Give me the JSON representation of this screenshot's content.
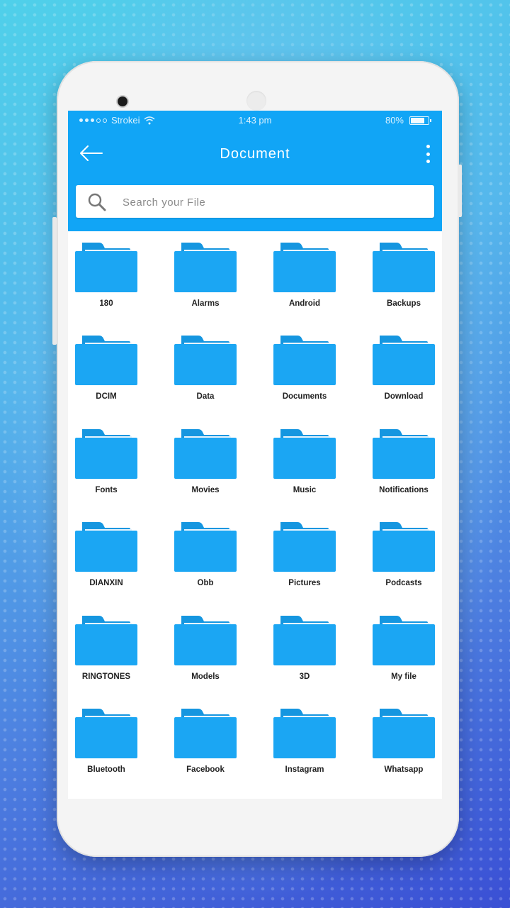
{
  "status_bar": {
    "carrier": "Strokei",
    "time": "1:43 pm",
    "battery": "80%",
    "battery_level": 0.8
  },
  "header": {
    "title": "Document",
    "back_icon": "arrow-left-icon",
    "menu_icon": "more-vert-icon"
  },
  "search": {
    "placeholder": "Search your File",
    "icon": "search-icon"
  },
  "colors": {
    "primary": "#11a5f6",
    "folder": "#1ba6f3",
    "folder_tab": "#1596e0"
  },
  "folders": [
    "180",
    "Alarms",
    "Android",
    "Backups",
    "DCIM",
    "Data",
    "Documents",
    "Download",
    "Fonts",
    "Movies",
    "Music",
    "Notifications",
    "DIANXIN",
    "Obb",
    "Pictures",
    "Podcasts",
    "RINGTONES",
    "Models",
    "3D",
    "My file",
    "Bluetooth",
    "Facebook",
    "Instagram",
    "Whatsapp"
  ]
}
